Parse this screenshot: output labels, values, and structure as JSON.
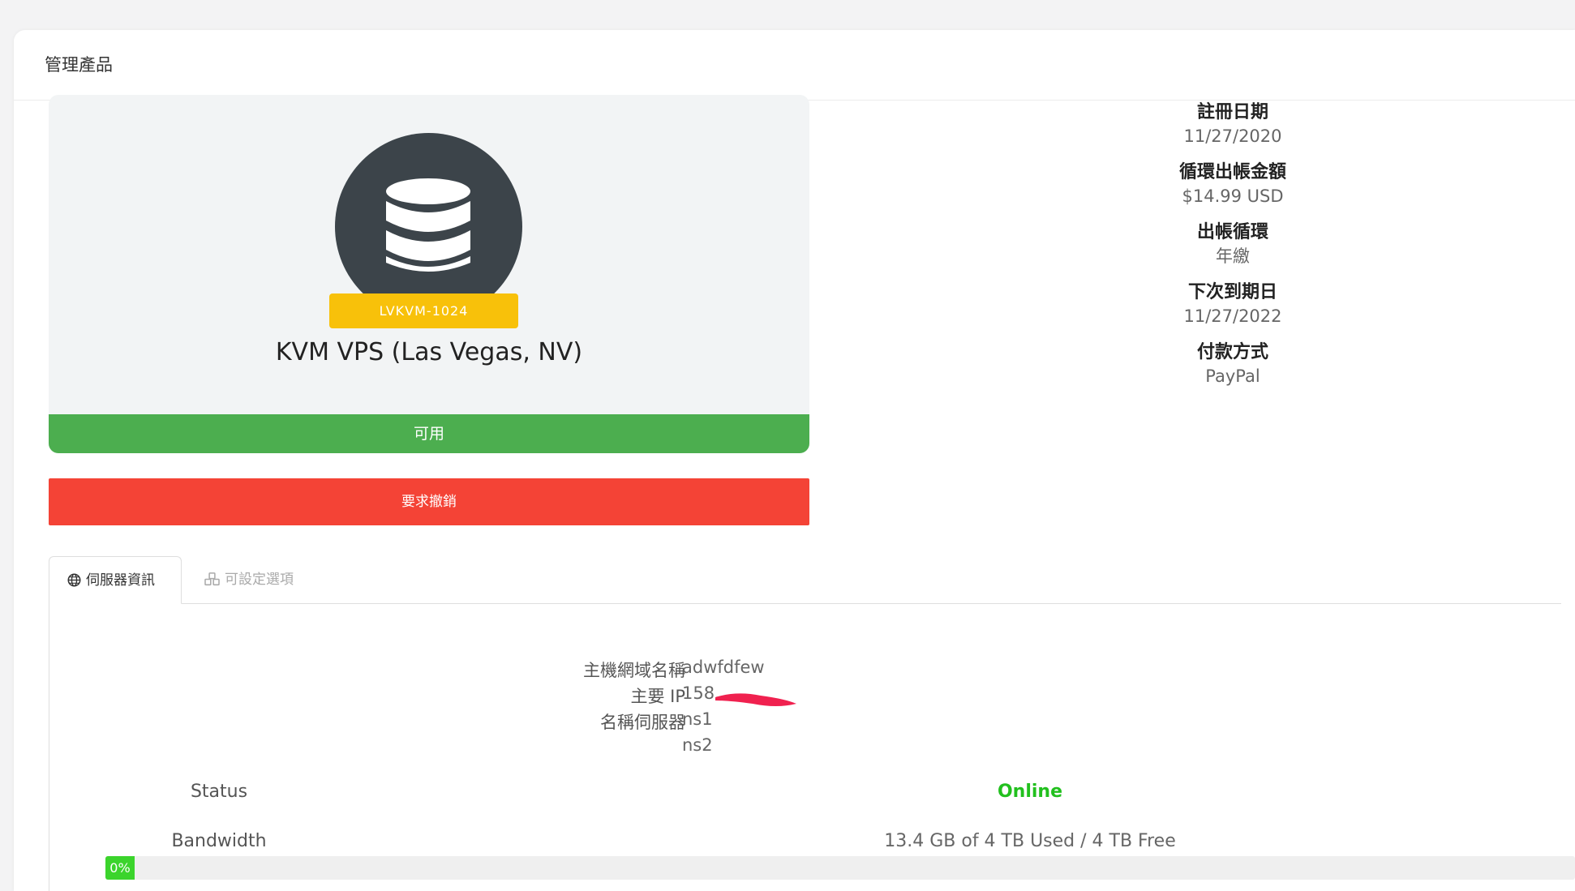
{
  "header": {
    "title": "管理產品"
  },
  "product": {
    "icon": "database-icon",
    "badge": "LVKVM-1024",
    "name": "KVM VPS (Las Vegas, NV)",
    "status": "可用",
    "status_color": "#4cae4f",
    "badge_color": "#f8c10a"
  },
  "actions": {
    "cancel_label": "要求撤銷",
    "cancel_color": "#f44336"
  },
  "billing": {
    "items": [
      {
        "label": "註冊日期",
        "value": "11/27/2020"
      },
      {
        "label": "循環出帳金額",
        "value": "$14.99 USD"
      },
      {
        "label": "出帳循環",
        "value": "年繳"
      },
      {
        "label": "下次到期日",
        "value": "11/27/2022"
      },
      {
        "label": "付款方式",
        "value": "PayPal"
      }
    ]
  },
  "tabs": [
    {
      "label": "伺服器資訊",
      "icon": "globe-icon",
      "active": true
    },
    {
      "label": "可設定選項",
      "icon": "cubes-icon",
      "active": false
    }
  ],
  "server": {
    "hostname_label": "主機網域名稱",
    "hostname": "adwfdfew",
    "ip_label": "主要 IP",
    "ip": "158.",
    "nameservers_label": "名稱伺服器",
    "ns1": "ns1",
    "ns2": "ns2",
    "status_label": "Status",
    "status_value": "Online",
    "status_color": "#22c01e",
    "bandwidth_label": "Bandwidth",
    "bandwidth_value": "13.4 GB of 4 TB Used / 4 TB Free",
    "bandwidth_progress_label": "0%",
    "bandwidth_progress_percent": 0
  }
}
